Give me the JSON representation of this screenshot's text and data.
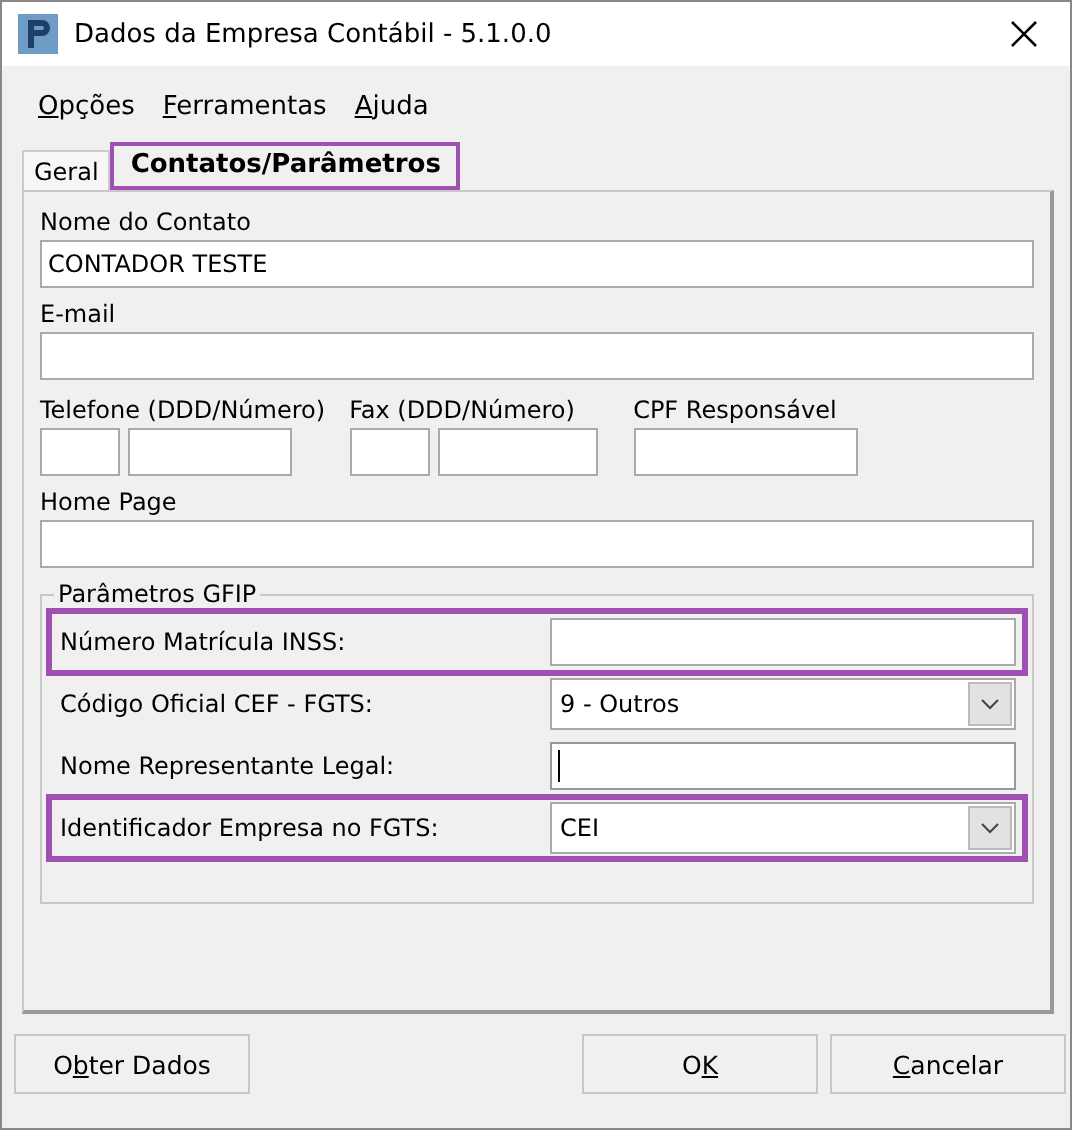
{
  "window": {
    "title": "Dados da Empresa Contábil - 5.1.0.0"
  },
  "menu": [
    {
      "key": "O",
      "after": "pções"
    },
    {
      "key": "F",
      "after": "erramentas"
    },
    {
      "key": "A",
      "after": "juda"
    }
  ],
  "tabs": [
    {
      "label": "Geral",
      "selected": false,
      "highlighted": false
    },
    {
      "label": "Contatos/Parâmetros",
      "selected": true,
      "highlighted": true
    }
  ],
  "contact": {
    "name_label": "Nome do Contato",
    "name_value": "CONTADOR TESTE",
    "email_label": "E-mail",
    "phone_label": "Telefone (DDD/Número)",
    "fax_label": "Fax (DDD/Número)",
    "cpf_label": "CPF Responsável",
    "home_label": "Home Page"
  },
  "gfip": {
    "title": "Parâmetros GFIP",
    "rows": [
      {
        "label": "Número Matrícula INSS:",
        "kind": "text",
        "highlighted": true,
        "focused": false
      },
      {
        "label": "Código Oficial CEF - FGTS:",
        "kind": "select",
        "value": "9 - Outros",
        "highlighted": false
      },
      {
        "label": "Nome Representante Legal:",
        "kind": "text",
        "highlighted": false,
        "focused": true
      },
      {
        "label": "Identificador Empresa no FGTS:",
        "kind": "select",
        "value": "CEI",
        "highlighted": true
      }
    ]
  },
  "buttons": [
    {
      "before": "O",
      "key": "b",
      "after": "ter Dados",
      "kind": "extra"
    },
    {
      "before": "O",
      "key": "K",
      "kind": "dialog"
    },
    {
      "key": "C",
      "after": "ancelar",
      "kind": "dialog"
    }
  ]
}
